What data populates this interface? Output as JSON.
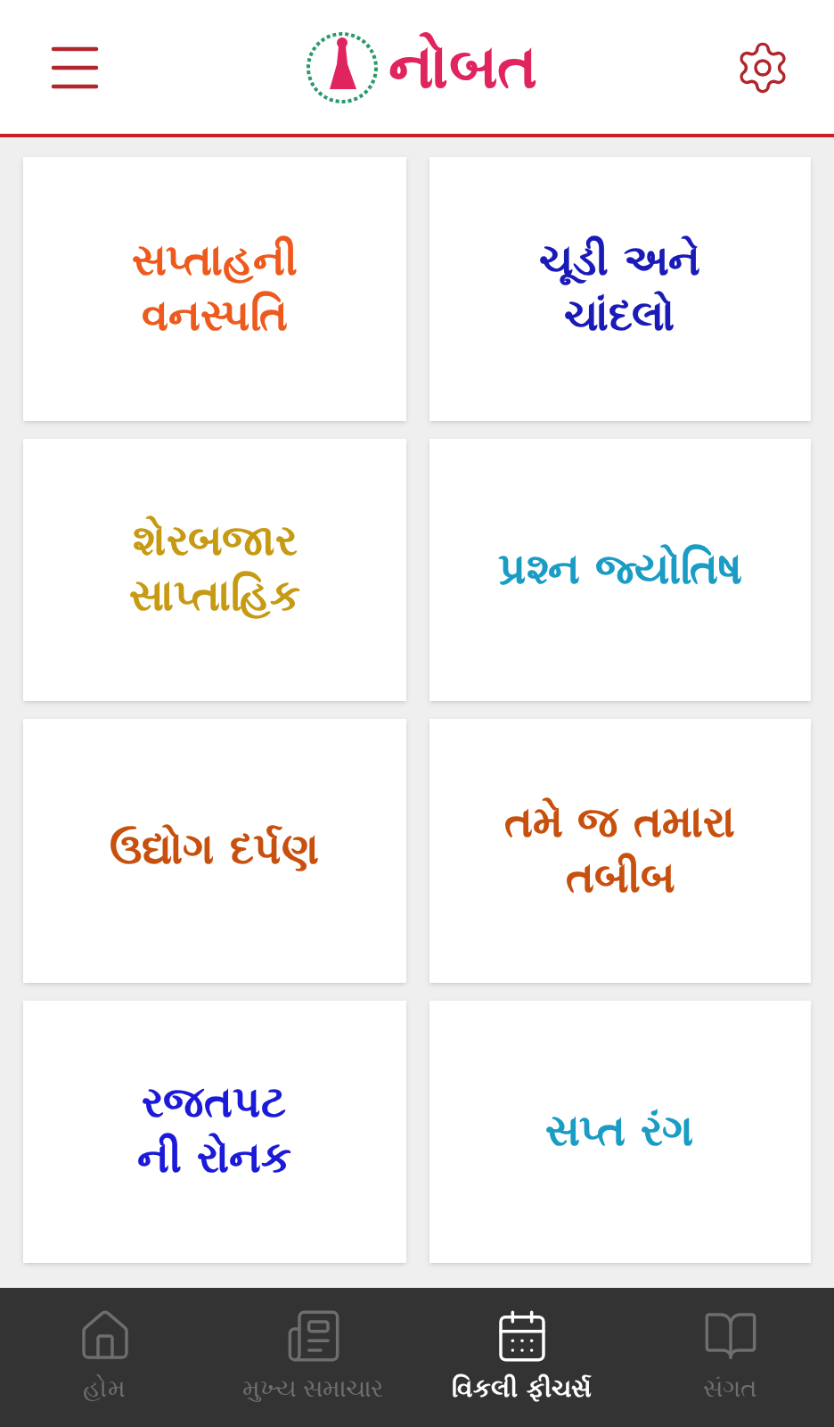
{
  "header": {
    "logo": "નોબત"
  },
  "tile_rows": [
    {
      "tiles": [
        {
          "lines": [
            "સપ્તાહની",
            "વનસ્પતિ"
          ],
          "color": "#ee5a1e"
        },
        {
          "lines": [
            "ચૂડી અને",
            "ચાંદલો"
          ],
          "color": "#1a1ab8"
        }
      ]
    },
    {
      "tiles": [
        {
          "lines": [
            "શેરબજાર",
            "સાપ્તાહિક"
          ],
          "color": "#c79a14"
        },
        {
          "lines": [
            "પ્રશ્ન જ્યોતિષ"
          ],
          "color": "#1a9cc4"
        }
      ]
    },
    {
      "tiles": [
        {
          "lines": [
            "ઉદ્યોગ દર્પણ"
          ],
          "color": "#c8500e"
        },
        {
          "lines": [
            "તમે જ તમારા",
            "તબીબ"
          ],
          "color": "#c8500e"
        }
      ]
    },
    {
      "tiles": [
        {
          "lines": [
            "રજતપટ",
            "ની રોનક"
          ],
          "color": "#1a1ad8"
        },
        {
          "lines": [
            "સપ્ત રંગ"
          ],
          "color": "#1a9cc4"
        }
      ]
    }
  ],
  "bottom_nav": [
    {
      "kind": "home",
      "label": "હોમ",
      "selected": false
    },
    {
      "kind": "news",
      "label": "મુખ્ય સમાચાર",
      "selected": false
    },
    {
      "kind": "calendar",
      "label": "વિકલી ફીચર્સ",
      "selected": true
    },
    {
      "kind": "book",
      "label": "સંગત",
      "selected": false
    }
  ]
}
